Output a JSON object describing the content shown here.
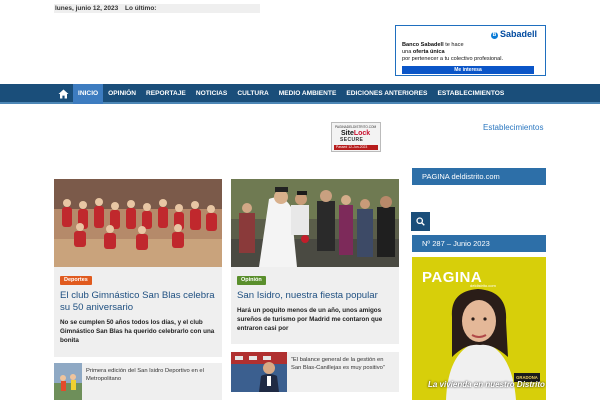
{
  "topbar": {
    "date": "lunes, junio 12, 2023",
    "latest_label": "Lo último:"
  },
  "ad": {
    "brand": "Sabadell",
    "brand_mark": "B",
    "line1_bold": "Banco Sabadell",
    "line1_rest": " te hace",
    "line2_pre": "una ",
    "line2_bold": "oferta única",
    "line3": "por pertenecer a tu colectivo profesional.",
    "cta": "Me interesa"
  },
  "nav": {
    "home_icon": "home-icon",
    "items": [
      "INICIO",
      "OPINIÓN",
      "REPORTAJE",
      "NOTICIAS",
      "CULTURA",
      "MEDIO AMBIENTE",
      "EDICIONES ANTERIORES",
      "ESTABLECIMIENTOS"
    ],
    "active": "INICIO"
  },
  "sitelock": {
    "domain": "PAGINADELDISTRITO.COM",
    "logo_a": "Site",
    "logo_b": "Lock",
    "secure": "SECURE",
    "status": "Passed  12-Jun-2023"
  },
  "establecimientos_link": "Establecimientos",
  "articles": [
    {
      "category": "Deportes",
      "title": "El club Gimnástico San Blas celebra su 50 aniversario",
      "excerpt": "No se cumplen 50 años todos los días, y el club Gimnástico San Blas ha querido celebrarlo con una bonita"
    },
    {
      "category": "Opinión",
      "title": "San Isidro, nuestra fiesta popular",
      "excerpt": "Hará un poquito menos de un año, unos amigos sureños de turismo por Madrid me contaron que entraron casi por"
    }
  ],
  "mini_articles": [
    {
      "title": "Primera edición del San Isidro Deportivo en el Metropolitano"
    },
    {
      "title": "“El balance general de la gestión en San Blas-Canillejas es muy positivo”"
    }
  ],
  "sidebar": {
    "site_heading": "PAGINA deldistrito.com",
    "search_icon": "search-icon",
    "issue_heading": "Nº 287 – Junio 2023",
    "cover": {
      "title": "PAGINA",
      "subtitle": "deldistrito.com",
      "badge": "GRADONA",
      "headline": "La vivienda en nuestro Distrito"
    }
  }
}
